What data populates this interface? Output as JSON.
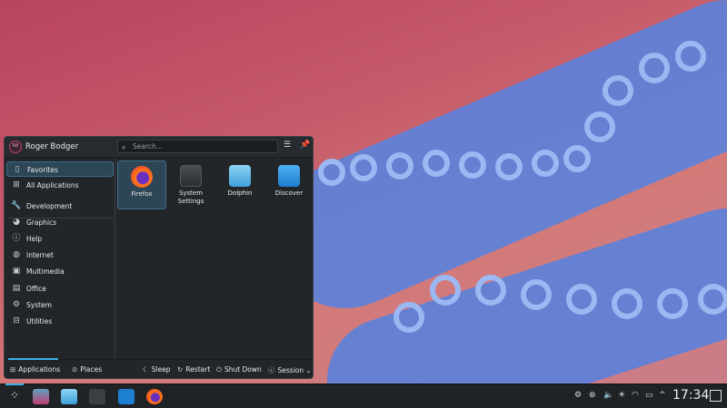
{
  "user": {
    "name": "Roger Bodger",
    "initials": "RB"
  },
  "search": {
    "placeholder": "Search..."
  },
  "sidebar": {
    "items": [
      {
        "label": "Favorites",
        "icon": "bookmark-icon",
        "selected": true
      },
      {
        "label": "All Applications",
        "icon": "grid-icon"
      },
      {
        "label": "Development",
        "icon": "wrench-icon"
      },
      {
        "label": "Graphics",
        "icon": "palette-icon"
      },
      {
        "label": "Help",
        "icon": "help-icon"
      },
      {
        "label": "Internet",
        "icon": "globe-icon"
      },
      {
        "label": "Multimedia",
        "icon": "monitor-icon"
      },
      {
        "label": "Office",
        "icon": "document-icon"
      },
      {
        "label": "System",
        "icon": "gear-icon"
      },
      {
        "label": "Utilities",
        "icon": "toolbox-icon"
      }
    ]
  },
  "apps": [
    {
      "label": "Firefox",
      "selected": true
    },
    {
      "label": "System Settings"
    },
    {
      "label": "Dolphin"
    },
    {
      "label": "Discover"
    }
  ],
  "footer": {
    "applications": "Applications",
    "places": "Places",
    "sleep": "Sleep",
    "restart": "Restart",
    "shutdown": "Shut Down",
    "session": "Session"
  },
  "taskbar": {
    "clock": "17:34"
  },
  "colors": {
    "accent": "#3daee9",
    "panel": "#202326",
    "menu": "#232629"
  }
}
